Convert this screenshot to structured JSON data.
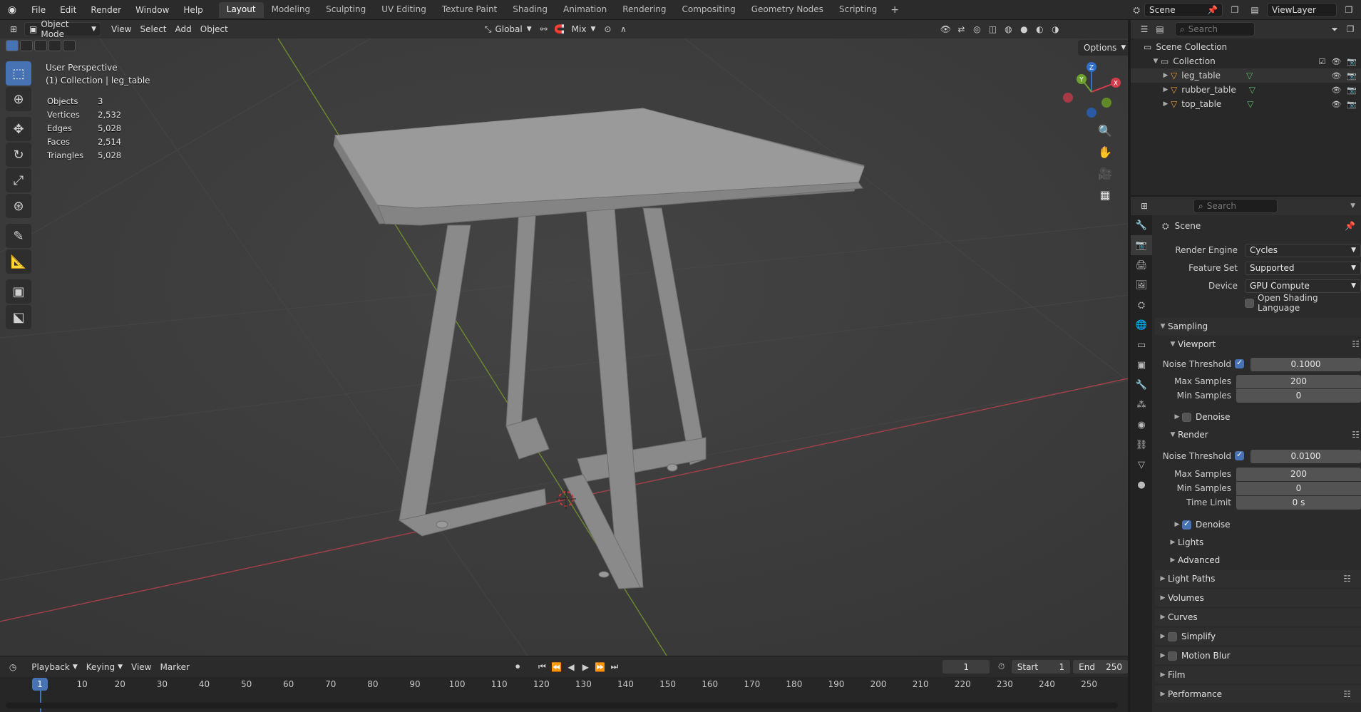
{
  "topbar": {
    "menus": [
      "File",
      "Edit",
      "Render",
      "Window",
      "Help"
    ],
    "workspaces": [
      "Layout",
      "Modeling",
      "Sculpting",
      "UV Editing",
      "Texture Paint",
      "Shading",
      "Animation",
      "Rendering",
      "Compositing",
      "Geometry Nodes",
      "Scripting"
    ],
    "active_workspace": "Layout",
    "scene": "Scene",
    "view_layer": "ViewLayer"
  },
  "viewport_header": {
    "mode": "Object Mode",
    "menus": [
      "View",
      "Select",
      "Add",
      "Object"
    ],
    "orientation": "Global",
    "snap": "Mix",
    "options": "Options"
  },
  "overlay": {
    "perspective": "User Perspective",
    "context": "(1) Collection | leg_table",
    "stats": [
      {
        "label": "Objects",
        "value": "3"
      },
      {
        "label": "Vertices",
        "value": "2,532"
      },
      {
        "label": "Edges",
        "value": "5,028"
      },
      {
        "label": "Faces",
        "value": "2,514"
      },
      {
        "label": "Triangles",
        "value": "5,028"
      }
    ]
  },
  "gizmo": {
    "x": "X",
    "y": "Y",
    "z": "Z"
  },
  "timeline": {
    "menus": [
      "Playback",
      "Keying",
      "View",
      "Marker"
    ],
    "current_frame": "1",
    "start_label": "Start",
    "start": "1",
    "end_label": "End",
    "end": "250",
    "ticks": [
      "10",
      "20",
      "30",
      "40",
      "50",
      "60",
      "70",
      "80",
      "90",
      "100",
      "110",
      "120",
      "130",
      "140",
      "150",
      "160",
      "170",
      "180",
      "190",
      "200",
      "210",
      "220",
      "230",
      "240",
      "250"
    ],
    "cursor_label": "1"
  },
  "outliner": {
    "search_placeholder": "Search",
    "scene_collection": "Scene Collection",
    "collection": "Collection",
    "objects": [
      "leg_table",
      "rubber_table",
      "top_table"
    ]
  },
  "properties": {
    "search_placeholder": "Search",
    "context": "Scene",
    "render_engine_label": "Render Engine",
    "render_engine": "Cycles",
    "feature_set_label": "Feature Set",
    "feature_set": "Supported",
    "device_label": "Device",
    "device": "GPU Compute",
    "osl": "Open Shading Language",
    "sampling": "Sampling",
    "viewport": "Viewport",
    "vp_noise_label": "Noise Threshold",
    "vp_noise": "0.1000",
    "vp_max_label": "Max Samples",
    "vp_max": "200",
    "vp_min_label": "Min Samples",
    "vp_min": "0",
    "denoise": "Denoise",
    "render": "Render",
    "r_noise_label": "Noise Threshold",
    "r_noise": "0.0100",
    "r_max_label": "Max Samples",
    "r_max": "200",
    "r_min_label": "Min Samples",
    "r_min": "0",
    "time_limit_label": "Time Limit",
    "time_limit": "0 s",
    "denoise2": "Denoise",
    "lights": "Lights",
    "advanced": "Advanced",
    "light_paths": "Light Paths",
    "volumes": "Volumes",
    "curves": "Curves",
    "simplify": "Simplify",
    "motion_blur": "Motion Blur",
    "film": "Film",
    "performance": "Performance"
  }
}
